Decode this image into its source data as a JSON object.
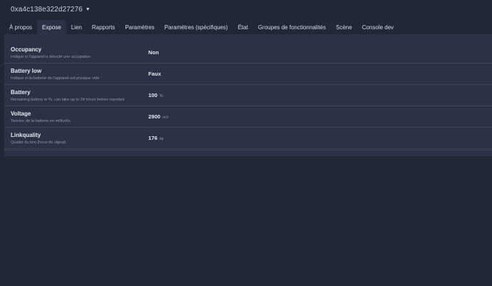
{
  "header": {
    "device_id": "0xa4c138e322d27276"
  },
  "tabs": [
    {
      "label": "À propos",
      "active": false
    },
    {
      "label": "Expose",
      "active": true
    },
    {
      "label": "Lien",
      "active": false
    },
    {
      "label": "Rapports",
      "active": false
    },
    {
      "label": "Paramètres",
      "active": false
    },
    {
      "label": "Paramètres (spécifiques)",
      "active": false
    },
    {
      "label": "État",
      "active": false
    },
    {
      "label": "Groupes de fonctionnalités",
      "active": false
    },
    {
      "label": "Scène",
      "active": false
    },
    {
      "label": "Console dev",
      "active": false
    }
  ],
  "expose": [
    {
      "name": "Occupancy",
      "description": "Indique si l'appareil a détecté une occupation",
      "value": "Non",
      "unit": ""
    },
    {
      "name": "Battery low",
      "description": "Indique si la batterie de l'appareil est presque vide",
      "value": "Faux",
      "unit": ""
    },
    {
      "name": "Battery",
      "description": "Remaining battery in %, can take up to 24 hours before reported",
      "value": "100",
      "unit": "%"
    },
    {
      "name": "Voltage",
      "description": "Tension de la batterie en millivolts",
      "value": "2900",
      "unit": "mV"
    },
    {
      "name": "Linkquality",
      "description": "Qualité du lien (force du signal)",
      "value": "176",
      "unit": "lqi"
    }
  ]
}
